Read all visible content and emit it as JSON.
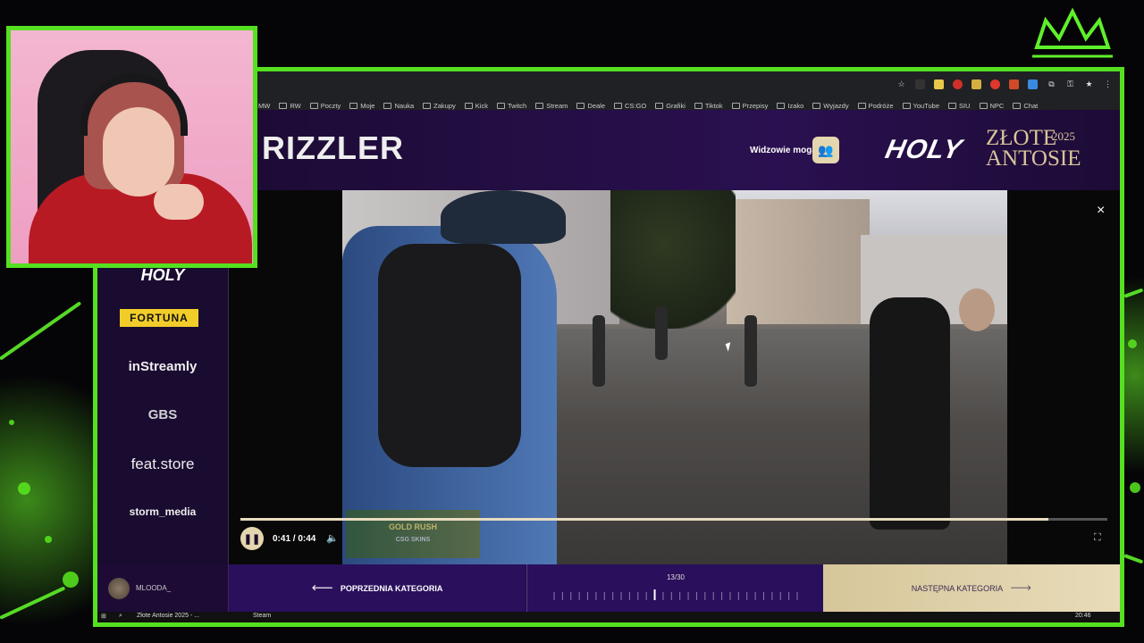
{
  "browser": {
    "bookmarks": [
      "MW",
      "RW",
      "Poczty",
      "Moje",
      "Nauka",
      "Zakupy",
      "Kick",
      "Twitch",
      "Stream",
      "Deale",
      "CS:GO",
      "Grafiki",
      "Tiktok",
      "Przepisy",
      "Izako",
      "Wyjazdy",
      "Podróże",
      "YouTube",
      "SIU",
      "NPC",
      "Chat"
    ]
  },
  "header": {
    "title": "RIZZLER",
    "viewers_label": "Widzowie mogą",
    "logo_holy": "HOLY",
    "logo_zlote": "ZŁOTE",
    "logo_antosie": "ANTOSIE",
    "logo_year": "2025"
  },
  "sponsors": {
    "holy": "HOLY",
    "fortuna": "FORTUNA",
    "instreamly": "inStreamly",
    "gbs": "GBS",
    "feat": "feat.store",
    "storm": "storm_media"
  },
  "player": {
    "time": "0:41 / 0:44",
    "progress": 0.932,
    "close": "×",
    "mini_ad_title": "GOLD RUSH",
    "mini_ad_sub": "CSG SKINS"
  },
  "bottom": {
    "username": "MLOODA_",
    "prev_label": "POPRZEDNIA KATEGORIA",
    "count": "13/30",
    "count_current": 13,
    "count_total": 30,
    "next_label": "NASTĘPNA KATEGORIA"
  },
  "taskbar": {
    "tab1": "Złote Antosie 2025 - ...",
    "tab2": "Steam",
    "clock": "20:46"
  },
  "colors": {
    "frame": "#55e020",
    "accent_gold": "#e4d6ae",
    "bg_purple": "#1d0b36"
  }
}
